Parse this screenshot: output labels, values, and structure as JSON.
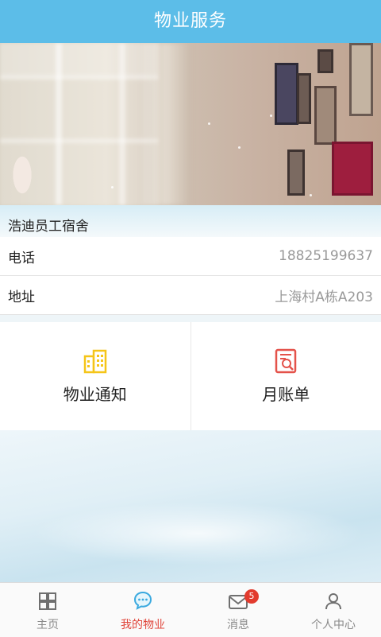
{
  "header": {
    "title": "物业服务"
  },
  "estate": {
    "name": "浩迪员工宿舍",
    "phone_label": "电话",
    "phone_value": "18825199637",
    "address_label": "地址",
    "address_value": "上海村A栋A203"
  },
  "tiles": [
    {
      "label": "物业通知",
      "icon": "building-icon"
    },
    {
      "label": "月账单",
      "icon": "bill-icon"
    }
  ],
  "tabbar": {
    "items": [
      {
        "label": "主页",
        "icon": "grid-icon"
      },
      {
        "label": "我的物业",
        "icon": "chat-bubble-icon",
        "active": true
      },
      {
        "label": "消息",
        "icon": "mail-icon",
        "badge": "5"
      },
      {
        "label": "个人中心",
        "icon": "person-icon"
      }
    ]
  },
  "colors": {
    "header": "#5cbde8",
    "active_tab": "#e0453a",
    "badge": "#e23b2e",
    "building_icon": "#f5c518",
    "bill_icon": "#e4524a"
  }
}
